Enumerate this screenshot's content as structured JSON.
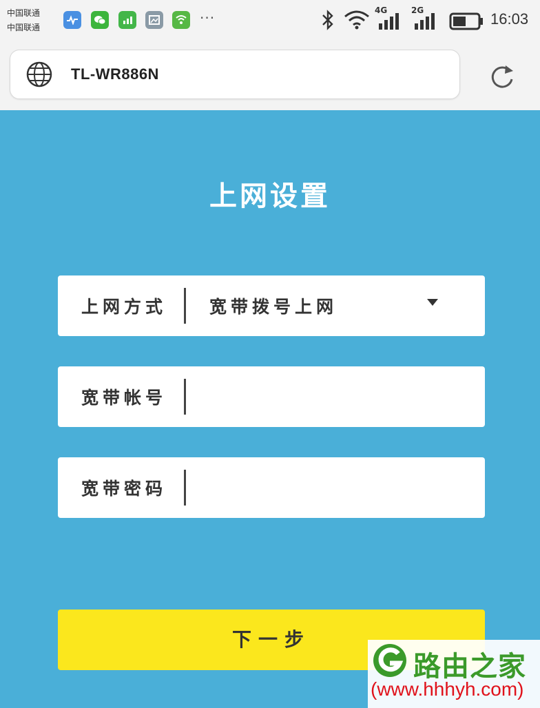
{
  "status_bar": {
    "carrier_1": "中国联通",
    "carrier_2": "中国联通",
    "overflow": "···",
    "network_1": "4G",
    "network_2": "2G",
    "time": "16:03"
  },
  "browser": {
    "url": "TL-WR886N"
  },
  "page": {
    "title": "上网设置",
    "fields": [
      {
        "label": "上网方式",
        "value": "宽带拨号上网"
      },
      {
        "label": "宽带帐号",
        "value": ""
      },
      {
        "label": "宽带密码",
        "value": ""
      }
    ],
    "next_button": "下一步"
  },
  "watermark": {
    "name": "路由之家",
    "url": "(www.hhhyh.com)"
  },
  "colors": {
    "background": "#4aafd8",
    "button": "#fbe71d",
    "watermark_green": "#3b9a2a",
    "watermark_red": "#e0121b"
  }
}
